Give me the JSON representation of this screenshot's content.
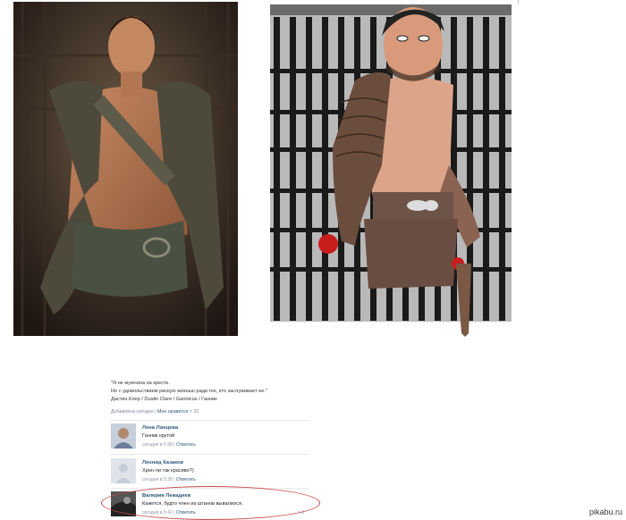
{
  "post": {
    "quote_line1": "\"Я не мужчина на кресте.",
    "quote_line2": "Но с удовольствием рискую жизнью ради тех, кто заслуживает ее.\"",
    "quote_line3": "Дастин Клер / Dustin Clare / Gannicus / Ганник",
    "added_text": "Добавлена сегодня",
    "like_text": "Мне нравится",
    "like_count": "32"
  },
  "comments": [
    {
      "name": "Лена Ланцева",
      "text": "Ганник крутой",
      "time": "сегодня в 5:38",
      "reply": "Ответить",
      "likes": ""
    },
    {
      "name": "Леонид Казаков",
      "text": "Хрен ли так красиво?)",
      "time": "сегодня в 5:38",
      "reply": "Ответить",
      "likes": ""
    },
    {
      "name": "Валерия Леваднев",
      "text": "Кажется, будто член из штанов вывалился.",
      "time": "сегодня в 5:42",
      "reply": "Ответить",
      "likes": "8"
    }
  ],
  "watermark": "pikabu.ru",
  "colors": {
    "link": "#2b587a",
    "highlight": "#c94949",
    "cage": "#2b2b2b",
    "skin": "#d8a88c",
    "leather": "#7a5a4a"
  }
}
